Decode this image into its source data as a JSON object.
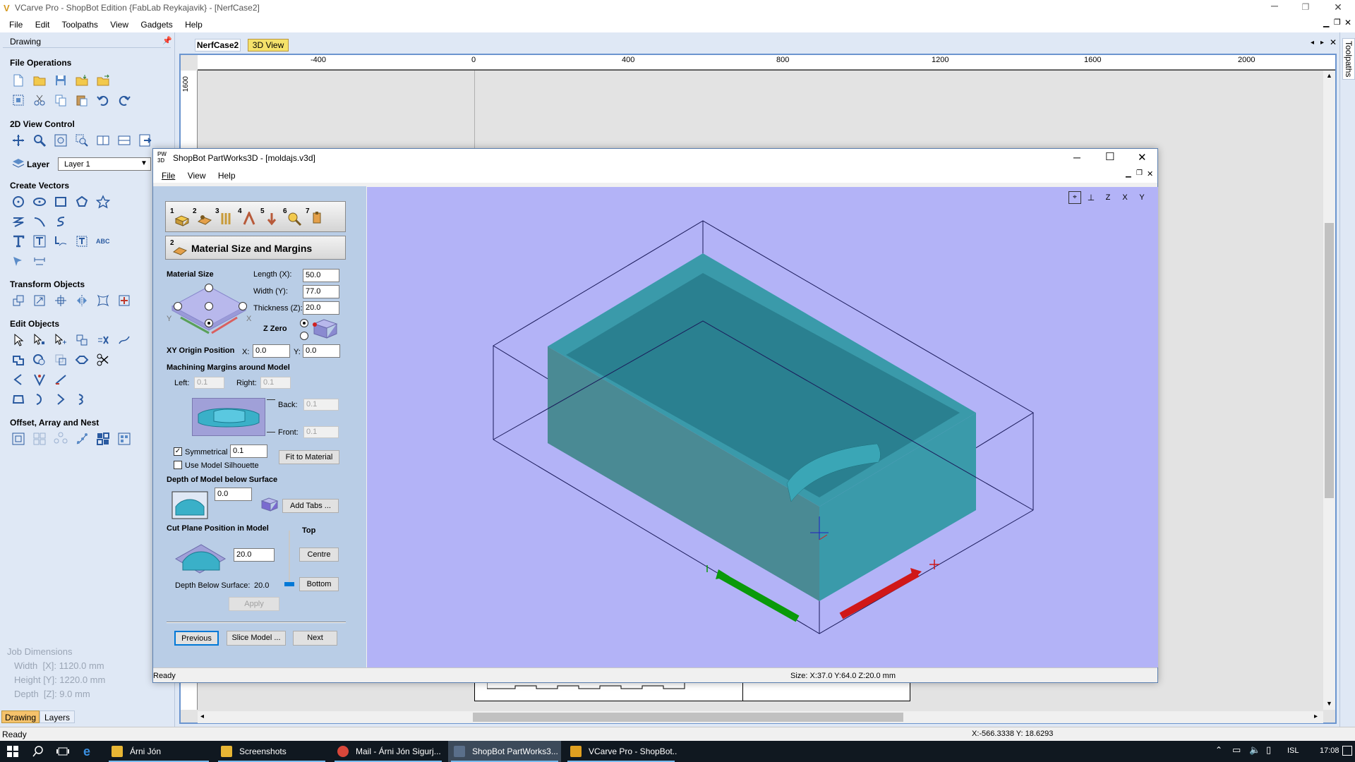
{
  "app": {
    "title": "VCarve Pro - ShopBot Edition {FabLab Reykajavik} - [NerfCase2]",
    "menu": [
      "File",
      "Edit",
      "Toolpaths",
      "View",
      "Gadgets",
      "Help"
    ],
    "status_left": "Ready",
    "status_coords": "X:-566.3338 Y: 18.6293",
    "tabs": [
      "NerfCase2",
      "3D View"
    ],
    "right_panel_label": "Toolpaths"
  },
  "drawing_panel": {
    "title": "Drawing",
    "sections": {
      "file_ops": "File Operations",
      "view_control": "2D View Control",
      "create_vectors": "Create Vectors",
      "transform": "Transform Objects",
      "edit": "Edit Objects",
      "offset": "Offset, Array and Nest"
    },
    "layer_label": "Layer",
    "layer_value": "Layer 1",
    "job_dimensions": {
      "title": "Job Dimensions",
      "width": "Width  [X]: 1120.0 mm",
      "height": "Height [Y]: 1220.0 mm",
      "depth": "Depth  [Z]: 9.0 mm"
    },
    "bottom_tabs": [
      "Drawing",
      "Layers"
    ]
  },
  "ruler": {
    "labels": [
      "-400",
      "0",
      "400",
      "800",
      "1200",
      "1600",
      "2000"
    ],
    "v_label": "1600"
  },
  "pw": {
    "title": "ShopBot PartWorks3D - [moldajs.v3d]",
    "menu": [
      "File",
      "View",
      "Help"
    ],
    "step_numbers": [
      "1",
      "2",
      "3",
      "4",
      "5",
      "6",
      "7"
    ],
    "panel_title": "Material Size and Margins",
    "panel_num": "2",
    "material_size": "Material Size",
    "length_label": "Length (X):",
    "length": "50.0",
    "width_label": "Width (Y):",
    "width": "77.0",
    "thickness_label": "Thickness (Z):",
    "thickness": "20.0",
    "zzero": "Z Zero",
    "diag_x": "X",
    "diag_y": "Y",
    "xy_origin": "XY Origin Position",
    "x_label": "X:",
    "x_val": "0.0",
    "y_label": "Y:",
    "y_val": "0.0",
    "margins_title": "Machining Margins around Model",
    "left_label": "Left:",
    "left_val": "0.1",
    "right_label": "Right:",
    "right_val": "0.1",
    "back_label": "Back:",
    "back_val": "0.1",
    "front_label": "Front:",
    "front_val": "0.1",
    "symmetrical": "Symmetrical",
    "sym_val": "0.1",
    "fit_to_material": "Fit to Material",
    "use_silhouette": "Use Model Silhouette",
    "depth_title": "Depth of Model below Surface",
    "depth_val": "0.0",
    "add_tabs": "Add Tabs ...",
    "cut_plane_title": "Cut Plane Position in Model",
    "top": "Top",
    "cut_val": "20.0",
    "centre": "Centre",
    "bottom": "Bottom",
    "depth_below": "Depth Below Surface:",
    "depth_below_val": "20.0",
    "apply": "Apply",
    "previous": "Previous",
    "slice_model": "Slice Model ...",
    "next": "Next",
    "status_left": "Ready",
    "status_size": "Size: X:37.0 Y:64.0 Z:20.0 mm",
    "view_buttons": [
      "fit",
      "iso",
      "Z",
      "X",
      "Y"
    ]
  },
  "taskbar": {
    "items": [
      {
        "label": "Árni Jón",
        "color": "#e8b634"
      },
      {
        "label": "Screenshots",
        "color": "#e8b634"
      },
      {
        "label": "Mail - Árni Jón Sigurj...",
        "color": "#d9473a"
      },
      {
        "label": "ShopBot PartWorks3...",
        "color": "#5a6f8a"
      },
      {
        "label": "VCarve Pro - ShopBot...",
        "color": "#e0a020"
      }
    ],
    "lang": "ISL",
    "time": "17:08"
  },
  "colors": {
    "viewport_bg": "#b3b3f7",
    "model": "#3a9aaa",
    "accent": "#0078d7"
  }
}
